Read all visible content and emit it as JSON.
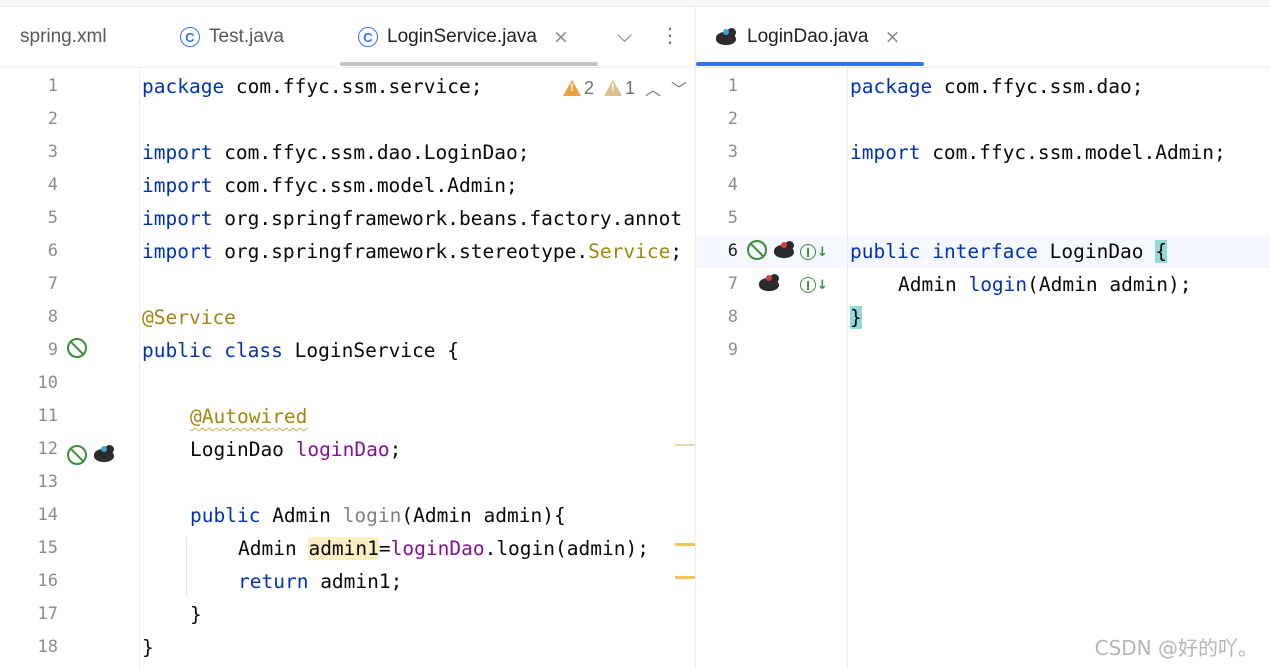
{
  "left_pane": {
    "tabs": [
      {
        "label": "spring.xml",
        "icon": "",
        "active": false
      },
      {
        "label": "Test.java",
        "icon": "class-icon",
        "active": false
      },
      {
        "label": "LoginService.java",
        "icon": "class-icon",
        "active": true,
        "closable": true
      }
    ],
    "class_icon_letter": "C",
    "close_glyph": "×",
    "dropdown_glyph": "⌵",
    "more_glyph": "⋮",
    "problems": {
      "warnings": "2",
      "weak_warnings": "1",
      "up": "︿",
      "down": "﹀"
    },
    "line_numbers": [
      "1",
      "2",
      "3",
      "4",
      "5",
      "6",
      "7",
      "8",
      "9",
      "10",
      "11",
      "12",
      "13",
      "14",
      "15",
      "16",
      "17",
      "18"
    ],
    "code": {
      "l1": {
        "kw": "package",
        "rest": " com.ffyc.ssm.service;"
      },
      "l3": {
        "kw": "import",
        "rest": " com.ffyc.ssm.dao.LoginDao;"
      },
      "l4": {
        "kw": "import",
        "rest": " com.ffyc.ssm.model.Admin;"
      },
      "l5": {
        "kw": "import",
        "rest": " org.springframework.beans.factory.annot"
      },
      "l6": {
        "kw": "import",
        "rest": " org.springframework.stereotype.",
        "type": "Service",
        "end": ";"
      },
      "l8": {
        "ann": "@Service"
      },
      "l9": {
        "kw1": "public",
        "kw2": "class",
        "rest": " LoginService {"
      },
      "l11": {
        "ann": "@Autowired"
      },
      "l12": {
        "type": "LoginDao ",
        "field": "loginDao",
        "end": ";"
      },
      "l14": {
        "kw": "public",
        "rest1": " Admin ",
        "method": "login",
        "rest2": "(Admin admin){"
      },
      "l15": {
        "pre": "Admin ",
        "var": "admin1",
        "eq": "=",
        "field": "loginDao",
        "rest": ".login(admin);"
      },
      "l16": {
        "kw": "return",
        "rest": " admin1;"
      },
      "l17": {
        "text": "}"
      },
      "l18": {
        "text": "}"
      }
    }
  },
  "right_pane": {
    "tab": {
      "label": "LoginDao.java",
      "icon": "mybatis-bird-icon",
      "active": true,
      "closable": true
    },
    "line_numbers": [
      "1",
      "2",
      "3",
      "4",
      "5",
      "6",
      "7",
      "8",
      "9"
    ],
    "implement_letter": "I",
    "implement_arrow": "↓",
    "code": {
      "l1": {
        "kw": "package",
        "rest": " com.ffyc.ssm.dao;"
      },
      "l3": {
        "kw": "import",
        "rest": " com.ffyc.ssm.model.Admin;"
      },
      "l6": {
        "kw1": "public",
        "kw2": "interface",
        "rest": " LoginDao ",
        "brace": "{"
      },
      "l7": {
        "pre": "Admin ",
        "method": "login",
        "rest": "(Admin admin);"
      },
      "l8": {
        "brace": "}"
      }
    }
  },
  "watermark": "CSDN @好的吖。",
  "colors": {
    "keyword": "#0033b3",
    "annotation": "#9e880d",
    "field": "#871094",
    "accent": "#3574f0",
    "warning": "#e8a33d"
  }
}
